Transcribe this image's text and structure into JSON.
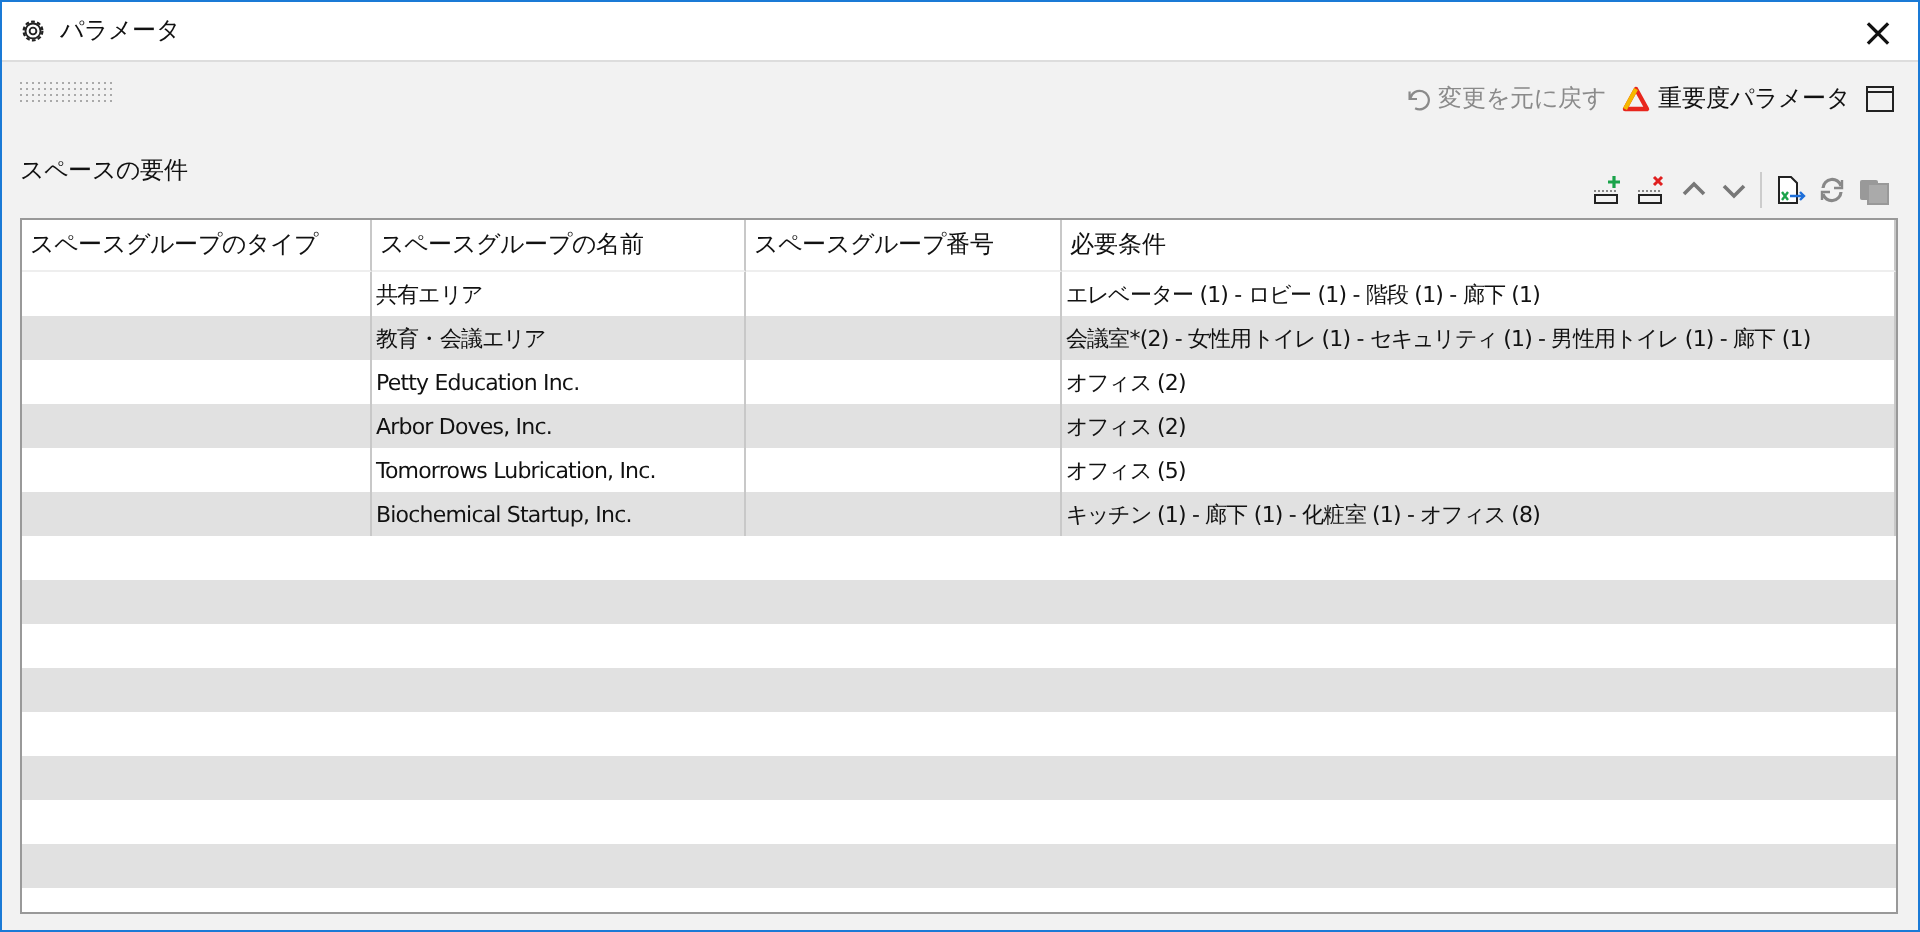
{
  "window": {
    "title": "パラメータ",
    "close": "×"
  },
  "toolbar": {
    "undo": {
      "label": "変更を元に戻す",
      "disabled": true
    },
    "importance": {
      "label": "重要度パラメータ"
    }
  },
  "section": {
    "title": "スペースの要件"
  },
  "table": {
    "columns": [
      "スペースグループのタイプ",
      "スペースグループの名前",
      "スペースグループ番号",
      "必要条件"
    ],
    "rows": [
      {
        "name": "共有エリア",
        "requirements": "エレベーター (1) - ロビー (1) - 階段 (1) - 廊下 (1)"
      },
      {
        "name": "教育・会議エリア",
        "requirements": "会議室*(2) - 女性用トイレ (1) - セキュリティ (1) - 男性用トイレ (1) - 廊下 (1)"
      },
      {
        "name": "Petty Education Inc.",
        "requirements": "オフィス (2)"
      },
      {
        "name": "Arbor Doves, Inc.",
        "requirements": "オフィス (2)"
      },
      {
        "name": "Tomorrows Lubrication, Inc.",
        "requirements": "オフィス (5)"
      },
      {
        "name": "Biochemical Startup, Inc.",
        "requirements": "キッチン (1) - 廊下 (1) - 化粧室 (1) - オフィス (8)"
      }
    ]
  }
}
